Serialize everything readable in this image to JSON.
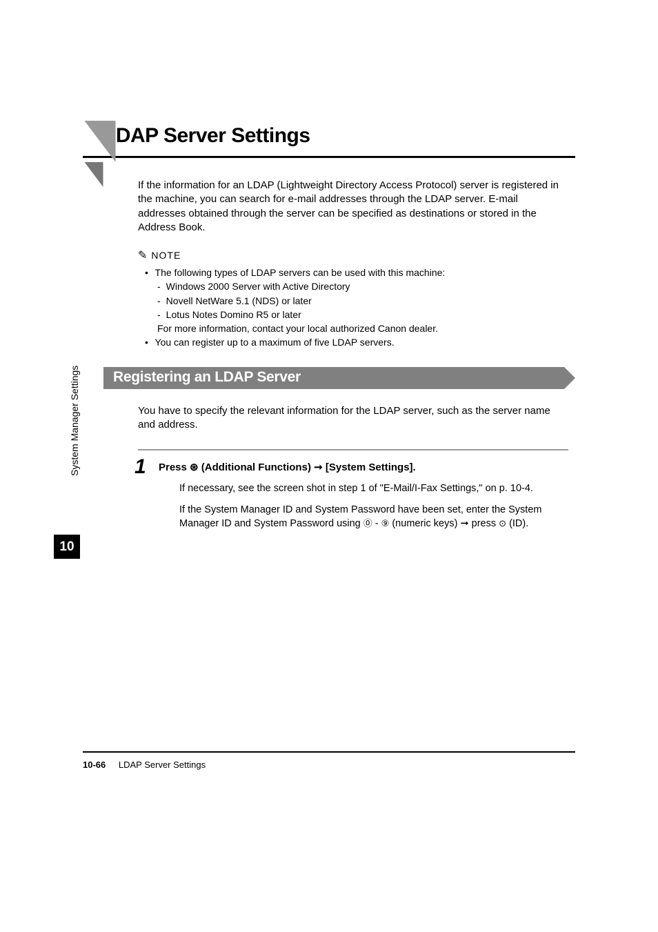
{
  "heading": "LDAP Server Settings",
  "intro": "If the information for an LDAP (Lightweight Directory Access Protocol) server is registered in the machine, you can search for e-mail addresses through the LDAP server. E-mail addresses obtained through the server can be specified as destinations or stored in the Address Book.",
  "note": {
    "label": "NOTE",
    "items": [
      {
        "text": "The following types of LDAP servers can be used with this machine:",
        "sub": [
          "Windows 2000 Server with Active Directory",
          "Novell NetWare 5.1 (NDS) or later",
          "Lotus Notes Domino R5 or later"
        ],
        "followup": "For more information, contact your local authorized Canon dealer."
      },
      {
        "text": "You can register up to a maximum of five LDAP servers."
      }
    ]
  },
  "subheading": "Registering an LDAP Server",
  "sub_para": "You have to specify the relevant information for the LDAP server, such as the server name and address.",
  "step": {
    "number": "1",
    "title_pre": "Press ",
    "title_icon": "⊛",
    "title_mid": " (Additional Functions) ",
    "title_arrow": "➞",
    "title_post": " [System Settings].",
    "body1": "If necessary, see the screen shot in step 1 of \"E-Mail/I-Fax Settings,\" on p. 10-4.",
    "body2_pre": "If the System Manager ID and System Password have been set, enter the System Manager ID and System Password using ",
    "body2_icon1": "⓪",
    "body2_dash": " - ",
    "body2_icon2": "⑨",
    "body2_mid": " (numeric keys) ",
    "body2_arrow": "➞",
    "body2_press": " press ",
    "body2_icon3": "⊙",
    "body2_post": " (ID)."
  },
  "sidebar": "System Manager Settings",
  "chapter": "10",
  "footer": {
    "page": "10-66",
    "title": "LDAP Server Settings"
  }
}
